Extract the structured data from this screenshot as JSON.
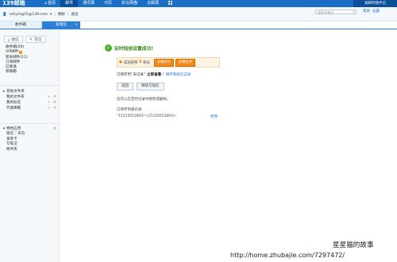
{
  "topbar": {
    "logo": "139邮箱",
    "nav": [
      {
        "label": "首页",
        "icon": "home-icon"
      },
      {
        "label": "邮件",
        "active": true
      },
      {
        "label": "通讯录"
      },
      {
        "label": "日历"
      },
      {
        "label": "彩云网盘"
      },
      {
        "label": "云邮局"
      }
    ],
    "right_text": "发邮件随手记"
  },
  "userbar": {
    "email": "cshyiing01@139.com",
    "dropdown": "▾",
    "skin": "换肤",
    "sep": "|",
    "logout": "退出",
    "search_placeholder": "搜索关键词",
    "right_links": [
      "帮助",
      "设置"
    ]
  },
  "tabs": {
    "inbox": "收件箱",
    "sms": "发短信",
    "close": "×"
  },
  "sidebar": {
    "compose_btn": "收信",
    "write_btn": "写信",
    "folders": [
      {
        "label": "收件箱(59)"
      },
      {
        "label": "VIP邮件",
        "vip": "V"
      },
      {
        "label": "新未邮件(11)"
      },
      {
        "label": "订阅邮件"
      },
      {
        "label": "已发送"
      },
      {
        "label": "草稿箱"
      }
    ],
    "other_folders": {
      "title": "其他文件夹",
      "items": [
        {
          "label": "我的文件夹",
          "acts": "+ ⚙"
        },
        {
          "label": "我的标签",
          "acts": "+ ⚙"
        },
        {
          "label": "代收邮箱",
          "acts": "+ ⚙"
        }
      ]
    },
    "apps": {
      "title": "特色应用",
      "rows": [
        [
          "短信",
          "彩信"
        ],
        [
          "发贺卡"
        ],
        [
          "写笔记"
        ],
        [
          "附件夹"
        ]
      ]
    }
  },
  "main": {
    "success_text": "定时短信设置成功!",
    "promo": {
      "label": "成功获得",
      "amount": "1",
      "unit": "积分",
      "btn1": "去做好礼",
      "btn2": "去做任务"
    },
    "saved_prefix": "已保存到“未记录”",
    "saved_link1": "立即查看",
    "saved_mid": "|",
    "saved_link2": "保存到短信记录",
    "btn_back": "返回",
    "btn_continue": "继续写短信",
    "note": "您可以在定时记录中修改或删除。",
    "saved_to": "已保存到通讯录",
    "recipients": "\"15216552803\"<15216552803>",
    "resend": "修改"
  },
  "watermark": {
    "line1": "星星猫的故事",
    "line2": "http://home.zhubajie.com/7297472/"
  },
  "colors": {
    "topbar": "#1a6fc4",
    "accent": "#2d7ed6",
    "success": "#4caf2a",
    "promo_btn": "#f28a1a"
  }
}
